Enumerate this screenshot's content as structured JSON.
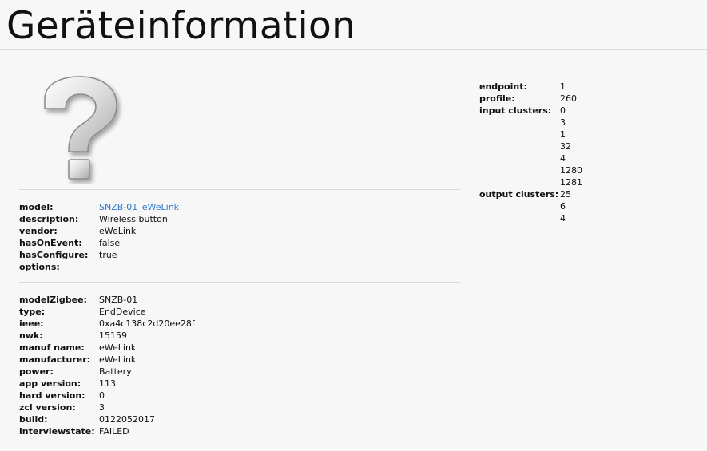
{
  "page": {
    "title": "Geräteinformation"
  },
  "device_image": {
    "icon": "question-mark-icon"
  },
  "model_info": [
    {
      "key": "model:",
      "value": "SNZB-01_eWeLink",
      "link": true
    },
    {
      "key": "description:",
      "value": "Wireless button"
    },
    {
      "key": "vendor:",
      "value": "eWeLink"
    },
    {
      "key": "hasOnEvent:",
      "value": "false"
    },
    {
      "key": "hasConfigure:",
      "value": "true"
    },
    {
      "key": "options:",
      "value": ""
    }
  ],
  "zigbee_info": [
    {
      "key": "modelZigbee:",
      "value": "SNZB-01"
    },
    {
      "key": "type:",
      "value": "EndDevice"
    },
    {
      "key": "ieee:",
      "value": "0xa4c138c2d20ee28f"
    },
    {
      "key": "nwk:",
      "value": "15159"
    },
    {
      "key": "manuf name:",
      "value": "eWeLink"
    },
    {
      "key": "manufacturer:",
      "value": "eWeLink"
    },
    {
      "key": "power:",
      "value": "Battery"
    },
    {
      "key": "app version:",
      "value": "113"
    },
    {
      "key": "hard version:",
      "value": "0"
    },
    {
      "key": "zcl version:",
      "value": "3"
    },
    {
      "key": "build:",
      "value": "0122052017"
    },
    {
      "key": "interviewstate:",
      "value": "FAILED"
    }
  ],
  "endpoint_info": [
    {
      "key": "endpoint:",
      "value": "1"
    },
    {
      "key": "profile:",
      "value": "260"
    },
    {
      "key": "input clusters:",
      "value": "0"
    },
    {
      "key": "",
      "value": "3"
    },
    {
      "key": "",
      "value": "1"
    },
    {
      "key": "",
      "value": "32"
    },
    {
      "key": "",
      "value": "4"
    },
    {
      "key": "",
      "value": "1280"
    },
    {
      "key": "",
      "value": "1281"
    },
    {
      "key": "output clusters:",
      "value": "25"
    },
    {
      "key": "",
      "value": "6"
    },
    {
      "key": "",
      "value": "4"
    }
  ]
}
